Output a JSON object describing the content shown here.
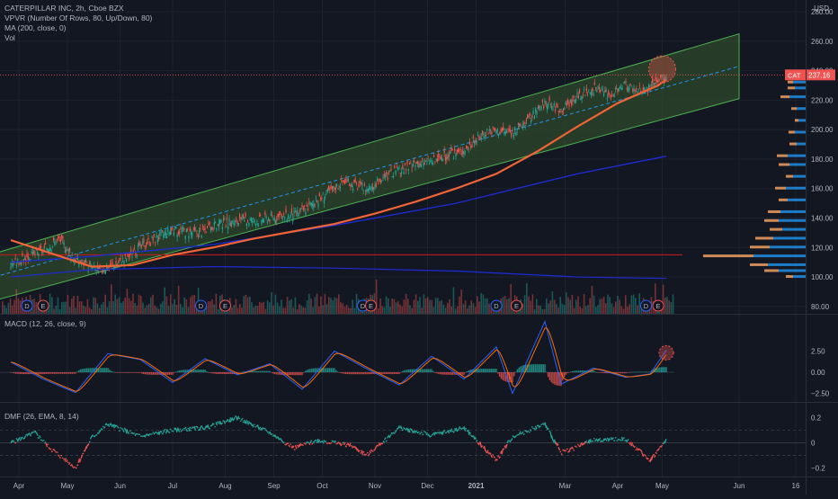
{
  "header": {
    "symbol_line": "CATERPILLAR INC, 2h, Cboe BZX",
    "indicator_1": "VPVR (Number Of Rows, 80, Up/Down, 80)",
    "indicator_2": "MA (200, close, 0)",
    "indicator_3": "Vol",
    "currency": "USD"
  },
  "price_tag": {
    "label": "CAT",
    "value": "237.16",
    "color": "#ef5350"
  },
  "colors": {
    "background": "#131722",
    "grid": "#1e222d",
    "up": "#26a69a",
    "down": "#ef5350",
    "channel_fill": "#2d4a2b",
    "channel_edge": "#4caf50",
    "channel_mid": "#2196f3",
    "ema_orange": "#f06437",
    "ma200": "#1e2bd8",
    "hline_red": "#b71c1c",
    "macd_line": "#2962ff",
    "signal_line": "#ff6d00",
    "dmf_up": "#26a69a",
    "dmf_down": "#ef5350"
  },
  "chart_data": [
    {
      "type": "candlestick",
      "title": "CATERPILLAR INC, 2h, Cboe BZX",
      "x_ticks": [
        "Apr",
        "May",
        "Jun",
        "Jul",
        "Aug",
        "Sep",
        "Oct",
        "Nov",
        "Dec",
        "2021",
        "Mar",
        "Apr",
        "May",
        "Jun",
        "16"
      ],
      "y_ticks": [
        80.0,
        100.0,
        120.0,
        140.0,
        160.0,
        180.0,
        200.0,
        220.0,
        240.0,
        260.0,
        280.0
      ],
      "ylim": [
        75,
        288
      ],
      "price_path": [
        [
          0,
          108
        ],
        [
          4,
          118
        ],
        [
          6,
          126
        ],
        [
          8,
          112
        ],
        [
          11,
          104
        ],
        [
          14,
          112
        ],
        [
          17,
          124
        ],
        [
          20,
          132
        ],
        [
          23,
          130
        ],
        [
          26,
          136
        ],
        [
          29,
          138
        ],
        [
          32,
          140
        ],
        [
          35,
          142
        ],
        [
          38,
          152
        ],
        [
          41,
          165
        ],
        [
          44,
          160
        ],
        [
          47,
          170
        ],
        [
          50,
          176
        ],
        [
          53,
          180
        ],
        [
          56,
          186
        ],
        [
          59,
          200
        ],
        [
          62,
          198
        ],
        [
          64,
          207
        ],
        [
          66,
          218
        ],
        [
          68,
          214
        ],
        [
          70,
          222
        ],
        [
          72,
          228
        ],
        [
          74,
          224
        ],
        [
          76,
          230
        ],
        [
          78,
          226
        ],
        [
          80,
          232
        ],
        [
          81,
          237
        ]
      ],
      "channel": {
        "start": [
          -2,
          116,
          84
        ],
        "end": [
          90,
          265,
          221
        ]
      },
      "ema_path": [
        [
          0,
          125
        ],
        [
          5,
          116
        ],
        [
          10,
          107
        ],
        [
          15,
          108
        ],
        [
          20,
          115
        ],
        [
          25,
          120
        ],
        [
          30,
          126
        ],
        [
          35,
          131
        ],
        [
          40,
          136
        ],
        [
          45,
          143
        ],
        [
          50,
          151
        ],
        [
          55,
          160
        ],
        [
          60,
          170
        ],
        [
          65,
          185
        ],
        [
          70,
          202
        ],
        [
          75,
          218
        ],
        [
          80,
          230
        ],
        [
          81,
          234
        ]
      ],
      "ma200_path": [
        [
          0,
          110
        ],
        [
          10,
          114
        ],
        [
          25,
          122
        ],
        [
          40,
          135
        ],
        [
          55,
          150
        ],
        [
          70,
          170
        ],
        [
          81,
          182
        ]
      ],
      "ma200_lower_path": [
        [
          0,
          100
        ],
        [
          10,
          105
        ],
        [
          25,
          107
        ],
        [
          40,
          106
        ],
        [
          55,
          104
        ],
        [
          70,
          100
        ],
        [
          81,
          99
        ]
      ],
      "hline": 115,
      "event_badges": [
        {
          "label": "D",
          "x": 2.0
        },
        {
          "label": "E",
          "x": 4.0
        },
        {
          "label": "D",
          "x": 23.5
        },
        {
          "label": "E",
          "x": 26.5
        },
        {
          "label": "D",
          "x": 43.5
        },
        {
          "label": "E",
          "x": 44.5
        },
        {
          "label": "D",
          "x": 60.0
        },
        {
          "label": "E",
          "x": 62.5
        },
        {
          "label": "D",
          "x": 78.5
        },
        {
          "label": "E",
          "x": 80.0
        }
      ],
      "vpvr_bins": [
        {
          "price": 232,
          "up": 14,
          "down": 6
        },
        {
          "price": 228,
          "up": 12,
          "down": 8
        },
        {
          "price": 222,
          "up": 18,
          "down": 10
        },
        {
          "price": 214,
          "up": 10,
          "down": 6
        },
        {
          "price": 206,
          "up": 8,
          "down": 4
        },
        {
          "price": 198,
          "up": 12,
          "down": 7
        },
        {
          "price": 190,
          "up": 10,
          "down": 8
        },
        {
          "price": 182,
          "up": 20,
          "down": 12
        },
        {
          "price": 176,
          "up": 18,
          "down": 12
        },
        {
          "price": 168,
          "up": 14,
          "down": 8
        },
        {
          "price": 160,
          "up": 22,
          "down": 12
        },
        {
          "price": 152,
          "up": 20,
          "down": 10
        },
        {
          "price": 144,
          "up": 28,
          "down": 14
        },
        {
          "price": 138,
          "up": 30,
          "down": 16
        },
        {
          "price": 132,
          "up": 26,
          "down": 14
        },
        {
          "price": 126,
          "up": 36,
          "down": 20
        },
        {
          "price": 120,
          "up": 40,
          "down": 22
        },
        {
          "price": 114,
          "up": 58,
          "down": 56
        },
        {
          "price": 108,
          "up": 42,
          "down": 20
        },
        {
          "price": 104,
          "up": 30,
          "down": 16
        },
        {
          "price": 100,
          "up": 14,
          "down": 8
        }
      ]
    },
    {
      "type": "line",
      "title": "MACD (12, 26, close, 9)",
      "y_ticks": [
        2.5,
        0.0,
        -2.5
      ],
      "y_tick_labels": [
        "2.50",
        "0.00",
        "−2.50"
      ],
      "ylim": [
        -3.5,
        6.8
      ],
      "macd_path": [
        [
          0,
          1.2
        ],
        [
          4,
          -0.8
        ],
        [
          8,
          -2.4
        ],
        [
          12,
          2.2
        ],
        [
          16,
          1.5
        ],
        [
          20,
          -1.2
        ],
        [
          24,
          1.6
        ],
        [
          28,
          -0.3
        ],
        [
          32,
          1.0
        ],
        [
          36,
          -2.0
        ],
        [
          40,
          2.5
        ],
        [
          44,
          0.4
        ],
        [
          48,
          -1.5
        ],
        [
          52,
          1.9
        ],
        [
          56,
          -0.8
        ],
        [
          60,
          3.0
        ],
        [
          62,
          -2.5
        ],
        [
          66,
          6.0
        ],
        [
          68,
          -1.4
        ],
        [
          72,
          0.5
        ],
        [
          76,
          -0.6
        ],
        [
          79,
          -0.2
        ],
        [
          81,
          2.6
        ]
      ]
    },
    {
      "type": "line",
      "title": "DMF (26, EMA, 8, 14)",
      "y_ticks": [
        0.2,
        0.0,
        -0.2
      ],
      "y_tick_labels": [
        "0.2",
        "0",
        "−0.2"
      ],
      "ylim": [
        -0.27,
        0.32
      ],
      "dmf_path": [
        [
          0,
          0.0
        ],
        [
          3,
          0.08
        ],
        [
          5,
          -0.05
        ],
        [
          8,
          -0.2
        ],
        [
          10,
          0.04
        ],
        [
          12,
          0.15
        ],
        [
          16,
          0.05
        ],
        [
          20,
          0.1
        ],
        [
          24,
          0.12
        ],
        [
          28,
          0.2
        ],
        [
          32,
          0.08
        ],
        [
          35,
          -0.04
        ],
        [
          38,
          0.02
        ],
        [
          42,
          -0.02
        ],
        [
          44,
          -0.1
        ],
        [
          48,
          0.12
        ],
        [
          52,
          0.06
        ],
        [
          56,
          0.12
        ],
        [
          60,
          -0.14
        ],
        [
          62,
          0.05
        ],
        [
          66,
          0.15
        ],
        [
          68,
          -0.08
        ],
        [
          72,
          0.02
        ],
        [
          76,
          0.03
        ],
        [
          79,
          -0.14
        ],
        [
          81,
          0.02
        ]
      ]
    }
  ]
}
